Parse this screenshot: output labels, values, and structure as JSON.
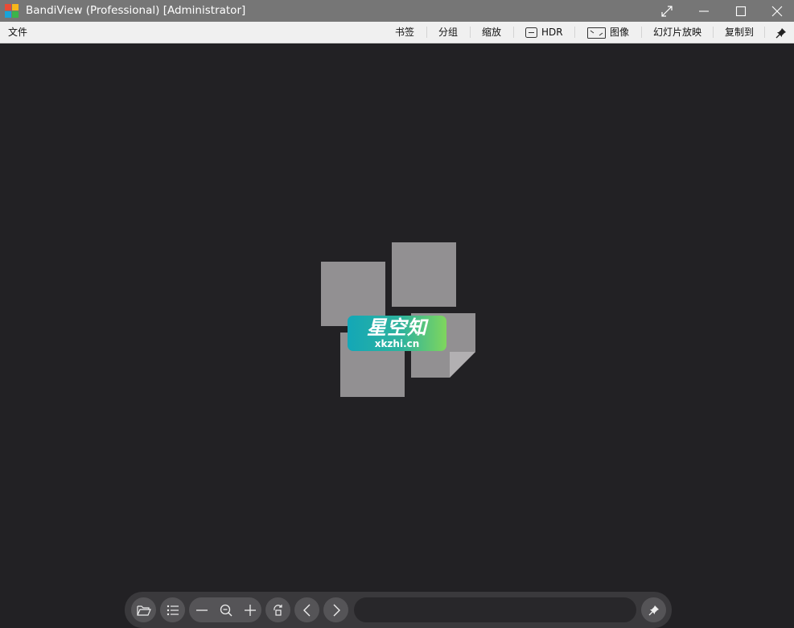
{
  "window": {
    "title": "BandiView (Professional) [Administrator]",
    "icons": [
      "app-logo-icon",
      "fullscreen-icon",
      "minimize-icon",
      "maximize-icon",
      "close-icon"
    ]
  },
  "menubar": {
    "file": "文件",
    "bookmark": "书签",
    "group": "分组",
    "zoom": "缩放",
    "hdr": "HDR",
    "image": "图像",
    "slideshow": "幻灯片放映",
    "copy_to": "复制到"
  },
  "watermark": {
    "title": "星空知",
    "subtitle": "xkzhi.cn"
  },
  "toolbar": {
    "icons": [
      "open-folder-icon",
      "list-icon",
      "zoom-out-icon",
      "zoom-fit-icon",
      "zoom-in-icon",
      "rotate-icon",
      "previous-icon",
      "next-icon",
      "pin-icon"
    ],
    "filename": ""
  },
  "colors": {
    "titlebar": "#767676",
    "menubar": "#f0f0f0",
    "canvas": "#222124",
    "tile": "#929092",
    "toolbar": "#3a393c"
  }
}
